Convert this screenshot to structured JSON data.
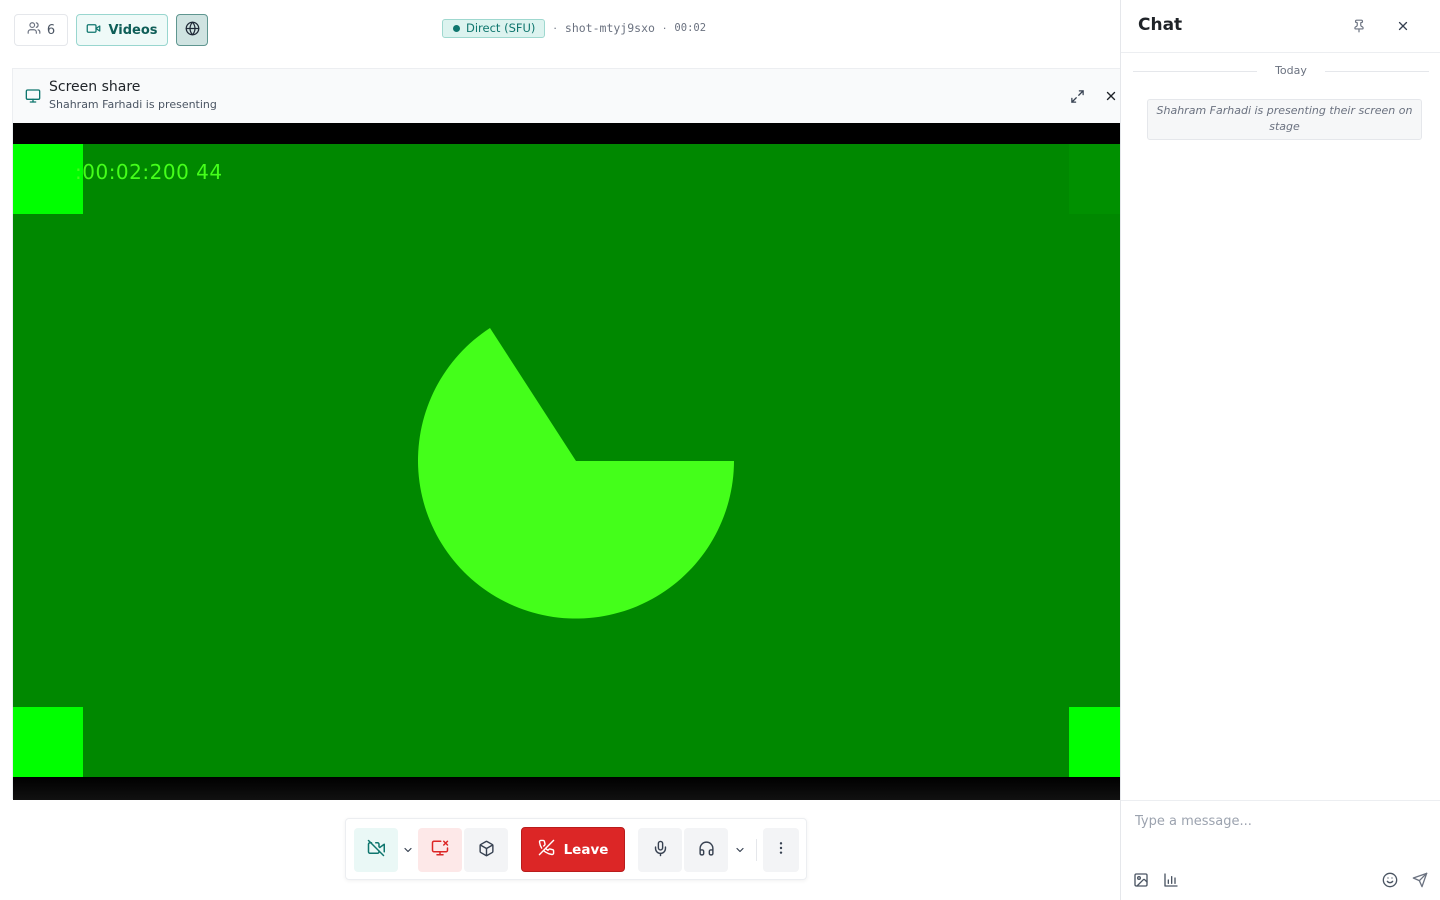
{
  "topbar": {
    "participants_count": "6",
    "videos_label": "Videos",
    "badge_label": "Direct (SFU)",
    "separator": "·",
    "session_id": "shot-mtyj9sxo",
    "elapsed": "00:02"
  },
  "screen_share": {
    "title": "Screen share",
    "subtitle": "Shahram Farhadi is presenting",
    "timecode": ":00:02:200 44"
  },
  "controls": {
    "leave_label": "Leave"
  },
  "chat": {
    "title": "Chat",
    "day_label": "Today",
    "system_message": "Shahram Farhadi is presenting their screen on stage",
    "input_placeholder": "Type a message..."
  },
  "colors": {
    "accent": "#0f766e",
    "danger": "#dc2626",
    "stage_green": "#008800",
    "bright_green": "#00ff00",
    "pie_green": "#44ff1a"
  },
  "icons": {
    "participants": "users-icon",
    "videos": "video-icon",
    "globe": "globe-icon",
    "monitor": "monitor-icon",
    "fullscreen": "expand-icon",
    "close": "close-icon",
    "camera_off": "video-off-icon",
    "share_off": "screen-share-off-icon",
    "box": "box-icon",
    "leave": "phone-off-icon",
    "mic": "mic-icon",
    "headphones": "headphones-icon",
    "more": "more-vertical-icon",
    "pin": "pin-icon",
    "image": "image-icon",
    "poll": "bar-chart-icon",
    "emoji": "smile-icon",
    "send": "send-icon"
  }
}
